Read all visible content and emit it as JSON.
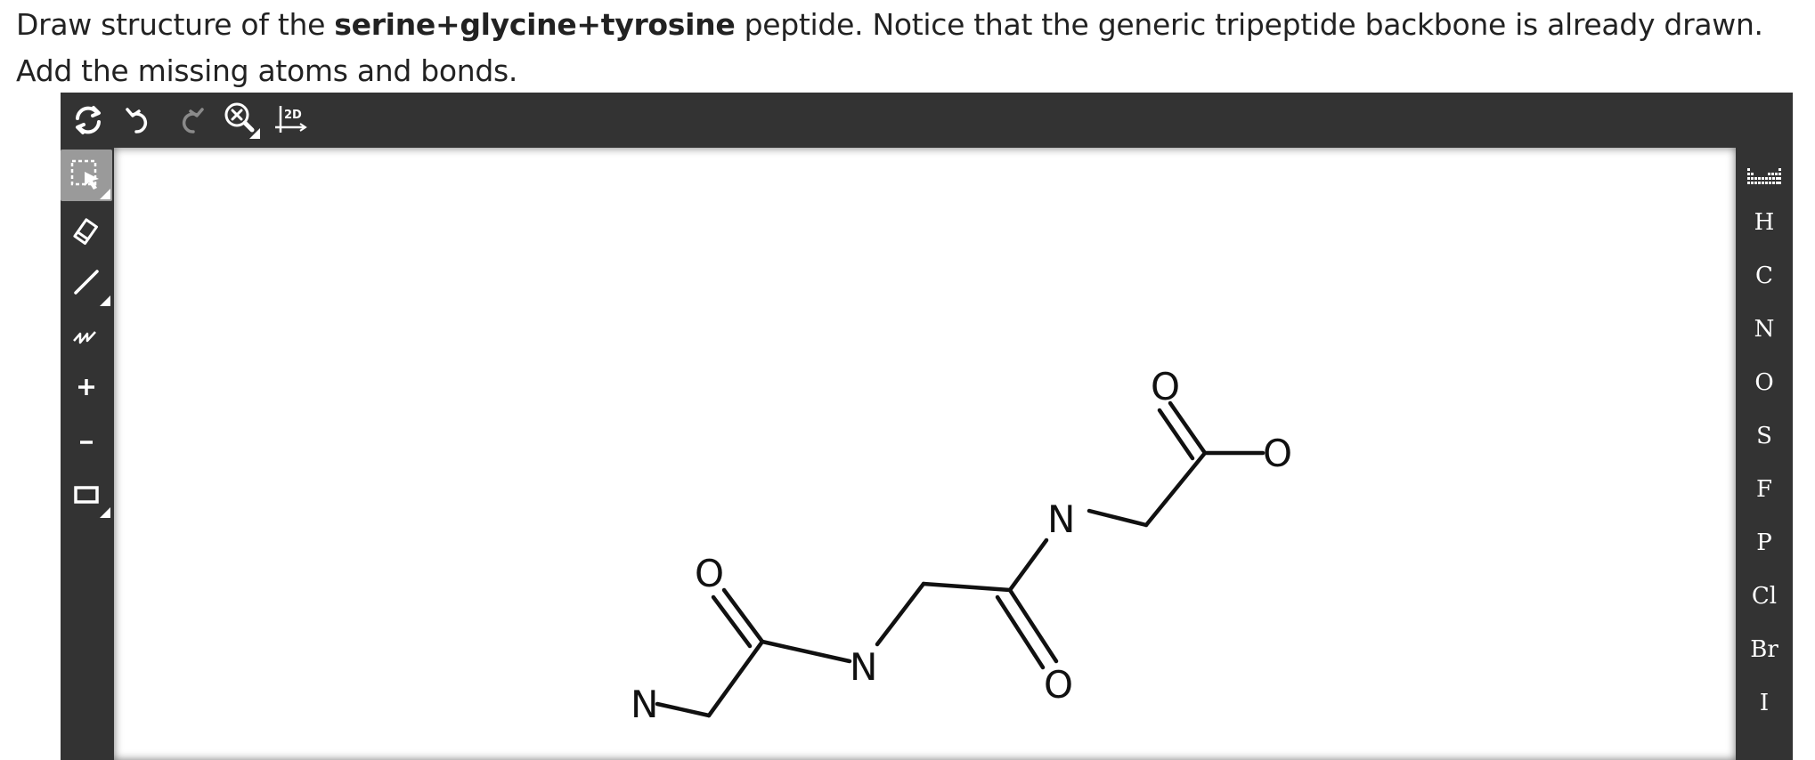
{
  "question": {
    "prefix": "Draw structure of the ",
    "bold": "serine+glycine+tyrosine",
    "suffix": " peptide. Notice that the generic tripeptide backbone is already drawn. Add the missing atoms and bonds."
  },
  "top_toolbar": {
    "buttons": [
      "clear-canvas-icon",
      "undo-icon",
      "redo-icon",
      "zoom-reset-icon",
      "layout-2d-icon"
    ],
    "layout_label": "2D"
  },
  "left_toolbar": {
    "tools": [
      "select-icon",
      "eraser-icon",
      "single-bond-icon",
      "chain-icon",
      "plus-charge-icon",
      "minus-charge-icon",
      "template-icon"
    ],
    "selected": "select-icon"
  },
  "right_toolbar": {
    "periodic_table": "periodic-table-icon",
    "elements": [
      "H",
      "C",
      "N",
      "O",
      "S",
      "F",
      "P",
      "Cl",
      "Br",
      "I"
    ]
  },
  "molecule": {
    "atom_labels": {
      "n1": "N",
      "n2": "N",
      "n3": "N",
      "o1": "O",
      "o2": "O",
      "o3": "O",
      "o4": "O"
    }
  }
}
